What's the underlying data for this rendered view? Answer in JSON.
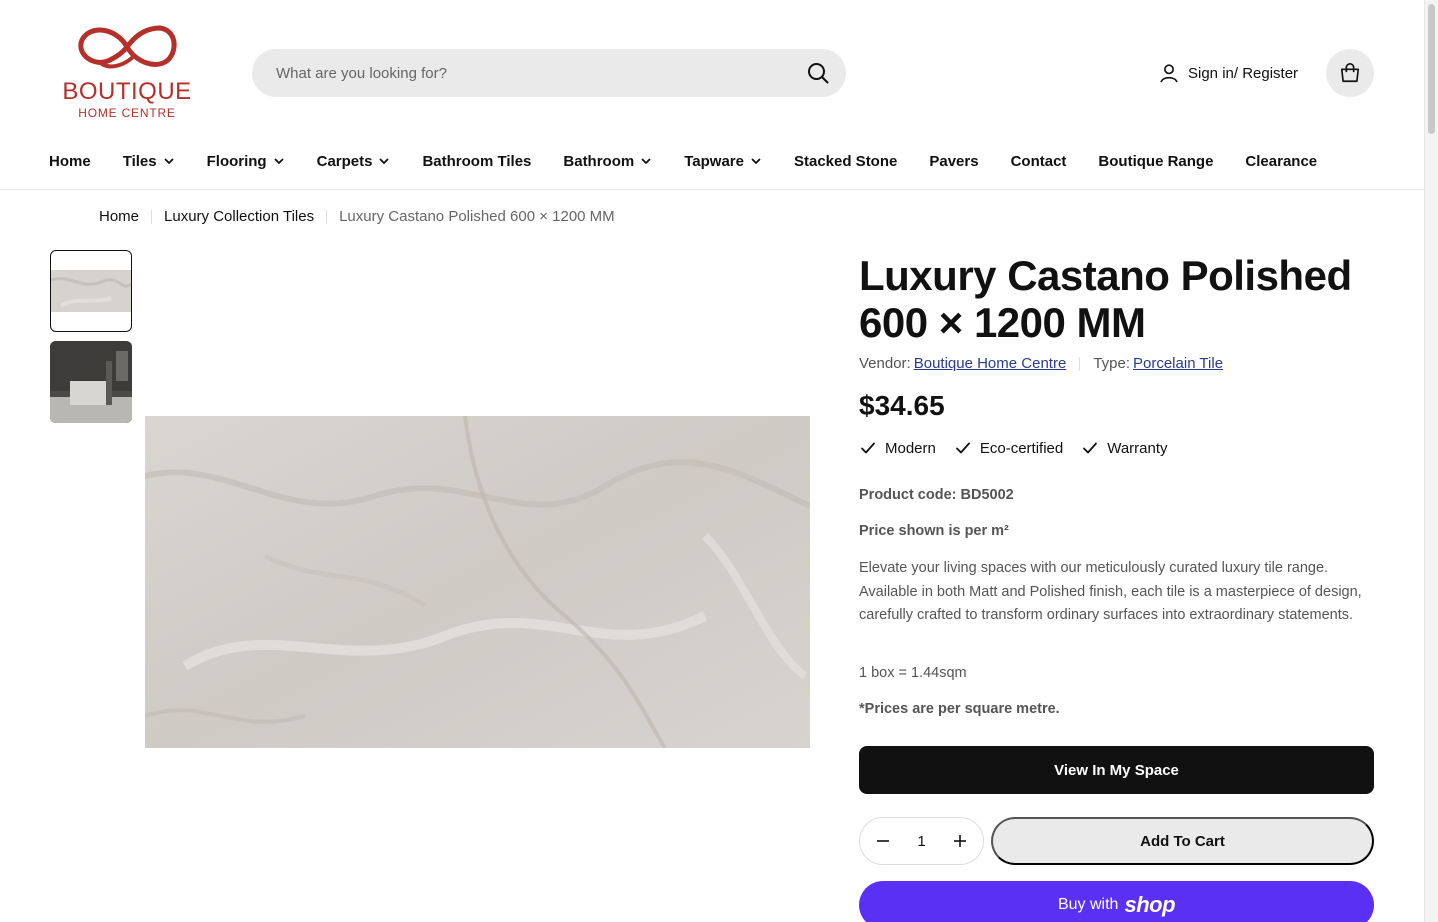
{
  "brand": {
    "name": "BOUTIQUE",
    "tagline": "HOME CENTRE",
    "color": "#b5302a"
  },
  "search": {
    "placeholder": "What are you looking for?"
  },
  "account": {
    "signin_label": "Sign in/ Register"
  },
  "nav": {
    "items": [
      {
        "label": "Home",
        "dropdown": false
      },
      {
        "label": "Tiles",
        "dropdown": true
      },
      {
        "label": "Flooring",
        "dropdown": true
      },
      {
        "label": "Carpets",
        "dropdown": true
      },
      {
        "label": "Bathroom Tiles",
        "dropdown": false
      },
      {
        "label": "Bathroom",
        "dropdown": true
      },
      {
        "label": "Tapware",
        "dropdown": true
      },
      {
        "label": "Stacked Stone",
        "dropdown": false
      },
      {
        "label": "Pavers",
        "dropdown": false
      },
      {
        "label": "Contact",
        "dropdown": false
      },
      {
        "label": "Boutique Range",
        "dropdown": false
      },
      {
        "label": "Clearance",
        "dropdown": false
      }
    ]
  },
  "breadcrumb": [
    "Home",
    "Luxury Collection Tiles",
    "Luxury Castano Polished 600 × 1200 MM"
  ],
  "product": {
    "title": "Luxury Castano Polished 600 × 1200 MM",
    "vendor_label": "Vendor:",
    "vendor": "Boutique Home Centre",
    "type_label": "Type:",
    "type": "Porcelain Tile",
    "price": "$34.65",
    "badges": [
      "Modern",
      "Eco-certified",
      "Warranty"
    ],
    "product_code": "Product code: BD5002",
    "price_note": "Price shown is per m²",
    "description": "Elevate your living spaces with our meticulously curated luxury tile range. Available in both Matt and Polished finish, each tile is a masterpiece of design, carefully crafted to transform ordinary surfaces into extraordinary statements.",
    "box_info": "1 box = 1.44sqm",
    "sqm_note": "*Prices are per square metre.",
    "quantity": "1"
  },
  "actions": {
    "view_space": "View In My Space",
    "add_to_cart": "Add To Cart",
    "buy_with": "Buy with",
    "shop_word": "shop",
    "shop_color": "#5a31f4"
  }
}
